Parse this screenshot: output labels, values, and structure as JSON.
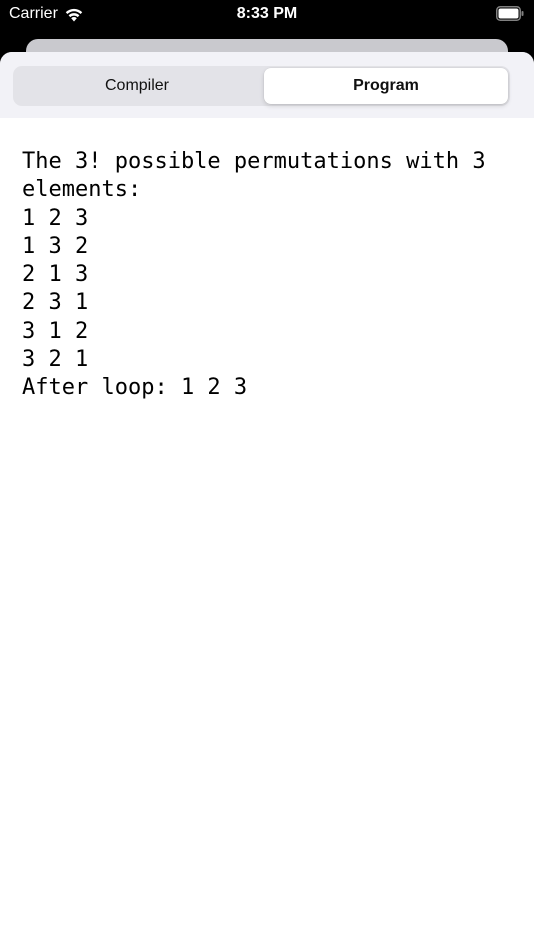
{
  "status_bar": {
    "carrier": "Carrier",
    "time": "8:33 PM"
  },
  "segmented_control": {
    "items": [
      {
        "label": "Compiler",
        "selected": false
      },
      {
        "label": "Program",
        "selected": true
      }
    ]
  },
  "output": {
    "lines": [
      "The 3! possible permutations with 3",
      "elements:",
      "1 2 3",
      "1 3 2",
      "2 1 3",
      "2 3 1",
      "3 1 2",
      "3 2 1",
      "After loop: 1 2 3"
    ]
  },
  "colors": {
    "status_bar_bg": "#000000",
    "segment_bg": "#e3e3e8",
    "selected_segment": "#ffffff",
    "page_bg": "#ffffff"
  }
}
